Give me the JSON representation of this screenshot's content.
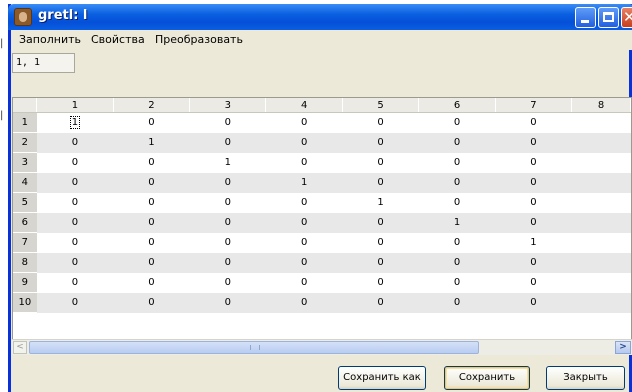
{
  "background": {
    "fragment": "|"
  },
  "window": {
    "title": "gretl: l"
  },
  "menu": [
    "Заполнить",
    "Свойства",
    "Преобразовать"
  ],
  "cell_ref": "1, 1",
  "columns": [
    "1",
    "2",
    "3",
    "4",
    "5",
    "6",
    "7",
    "8"
  ],
  "rows": [
    {
      "label": "1",
      "values": [
        "1",
        "0",
        "0",
        "0",
        "0",
        "0",
        "0"
      ]
    },
    {
      "label": "2",
      "values": [
        "0",
        "1",
        "0",
        "0",
        "0",
        "0",
        "0"
      ]
    },
    {
      "label": "3",
      "values": [
        "0",
        "0",
        "1",
        "0",
        "0",
        "0",
        "0"
      ]
    },
    {
      "label": "4",
      "values": [
        "0",
        "0",
        "0",
        "1",
        "0",
        "0",
        "0"
      ]
    },
    {
      "label": "5",
      "values": [
        "0",
        "0",
        "0",
        "0",
        "1",
        "0",
        "0"
      ]
    },
    {
      "label": "6",
      "values": [
        "0",
        "0",
        "0",
        "0",
        "0",
        "1",
        "0"
      ]
    },
    {
      "label": "7",
      "values": [
        "0",
        "0",
        "0",
        "0",
        "0",
        "0",
        "1"
      ]
    },
    {
      "label": "8",
      "values": [
        "0",
        "0",
        "0",
        "0",
        "0",
        "0",
        "0"
      ]
    },
    {
      "label": "9",
      "values": [
        "0",
        "0",
        "0",
        "0",
        "0",
        "0",
        "0"
      ]
    },
    {
      "label": "10",
      "values": [
        "0",
        "0",
        "0",
        "0",
        "0",
        "0",
        "0"
      ]
    }
  ],
  "buttons": {
    "save_as": "Сохранить как",
    "save": "Сохранить",
    "close": "Закрыть"
  },
  "colors": {
    "title_bar": "#0a5fe0",
    "default_button_glow": "#f5c45a"
  }
}
